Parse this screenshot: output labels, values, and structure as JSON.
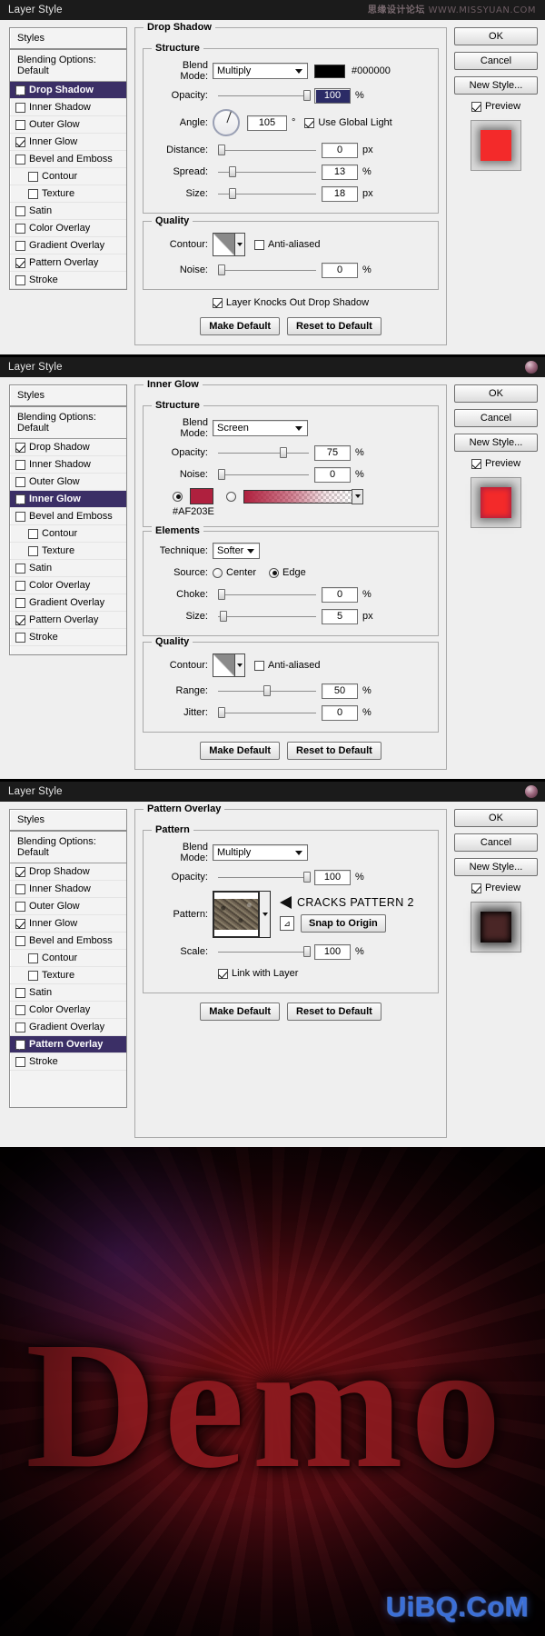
{
  "window": {
    "title": "Layer Style",
    "watermark_cn": "思缘设计论坛",
    "watermark_url": "WWW.MISSYUAN.COM"
  },
  "styles_list": {
    "header": "Styles",
    "blending_options": "Blending Options: Default",
    "items": [
      {
        "label": "Drop Shadow",
        "checked": true,
        "indent": false
      },
      {
        "label": "Inner Shadow",
        "checked": false,
        "indent": false
      },
      {
        "label": "Outer Glow",
        "checked": false,
        "indent": false
      },
      {
        "label": "Inner Glow",
        "checked": true,
        "indent": false
      },
      {
        "label": "Bevel and Emboss",
        "checked": false,
        "indent": false
      },
      {
        "label": "Contour",
        "checked": false,
        "indent": true
      },
      {
        "label": "Texture",
        "checked": false,
        "indent": true
      },
      {
        "label": "Satin",
        "checked": false,
        "indent": false
      },
      {
        "label": "Color Overlay",
        "checked": false,
        "indent": false
      },
      {
        "label": "Gradient Overlay",
        "checked": false,
        "indent": false
      },
      {
        "label": "Pattern Overlay",
        "checked": true,
        "indent": false
      },
      {
        "label": "Stroke",
        "checked": false,
        "indent": false
      }
    ]
  },
  "buttons": {
    "ok": "OK",
    "cancel": "Cancel",
    "new_style": "New Style...",
    "preview": "Preview",
    "make_default": "Make Default",
    "reset_to_default": "Reset to Default",
    "snap_to_origin": "Snap to Origin"
  },
  "labels": {
    "blend_mode": "Blend Mode:",
    "opacity": "Opacity:",
    "angle": "Angle:",
    "distance": "Distance:",
    "spread": "Spread:",
    "size": "Size:",
    "contour": "Contour:",
    "noise": "Noise:",
    "technique": "Technique:",
    "source": "Source:",
    "choke": "Choke:",
    "range": "Range:",
    "jitter": "Jitter:",
    "pattern": "Pattern:",
    "scale": "Scale:",
    "anti_aliased": "Anti-aliased",
    "use_global_light": "Use Global Light",
    "layer_knocks_out": "Layer Knocks Out Drop Shadow",
    "link_with_layer": "Link with Layer",
    "center": "Center",
    "edge": "Edge",
    "structure": "Structure",
    "quality": "Quality",
    "elements": "Elements",
    "pattern_group": "Pattern",
    "pct": "%",
    "px": "px",
    "deg": "°"
  },
  "drop_shadow": {
    "title": "Drop Shadow",
    "blend_mode": "Multiply",
    "color_hex": "#000000",
    "opacity": "100",
    "angle": "105",
    "use_global_light": true,
    "distance": "0",
    "spread": "13",
    "size": "18",
    "anti_aliased": false,
    "noise": "0",
    "layer_knocks_out": true,
    "selected_style": "Drop Shadow"
  },
  "inner_glow": {
    "title": "Inner Glow",
    "blend_mode": "Screen",
    "opacity": "75",
    "noise": "0",
    "color_hex": "#AF203E",
    "color_mode": "solid",
    "technique": "Softer",
    "source": "Edge",
    "choke": "0",
    "size": "5",
    "anti_aliased": false,
    "range": "50",
    "jitter": "0",
    "selected_style": "Inner Glow"
  },
  "pattern_overlay": {
    "title": "Pattern Overlay",
    "blend_mode": "Multiply",
    "opacity": "100",
    "pattern_name": "CRACKS PATTERN 2",
    "scale": "100",
    "link_with_layer": true,
    "selected_style": "Pattern Overlay"
  },
  "artwork": {
    "text": "Demo",
    "site_watermark": "UiBQ.CoM"
  }
}
